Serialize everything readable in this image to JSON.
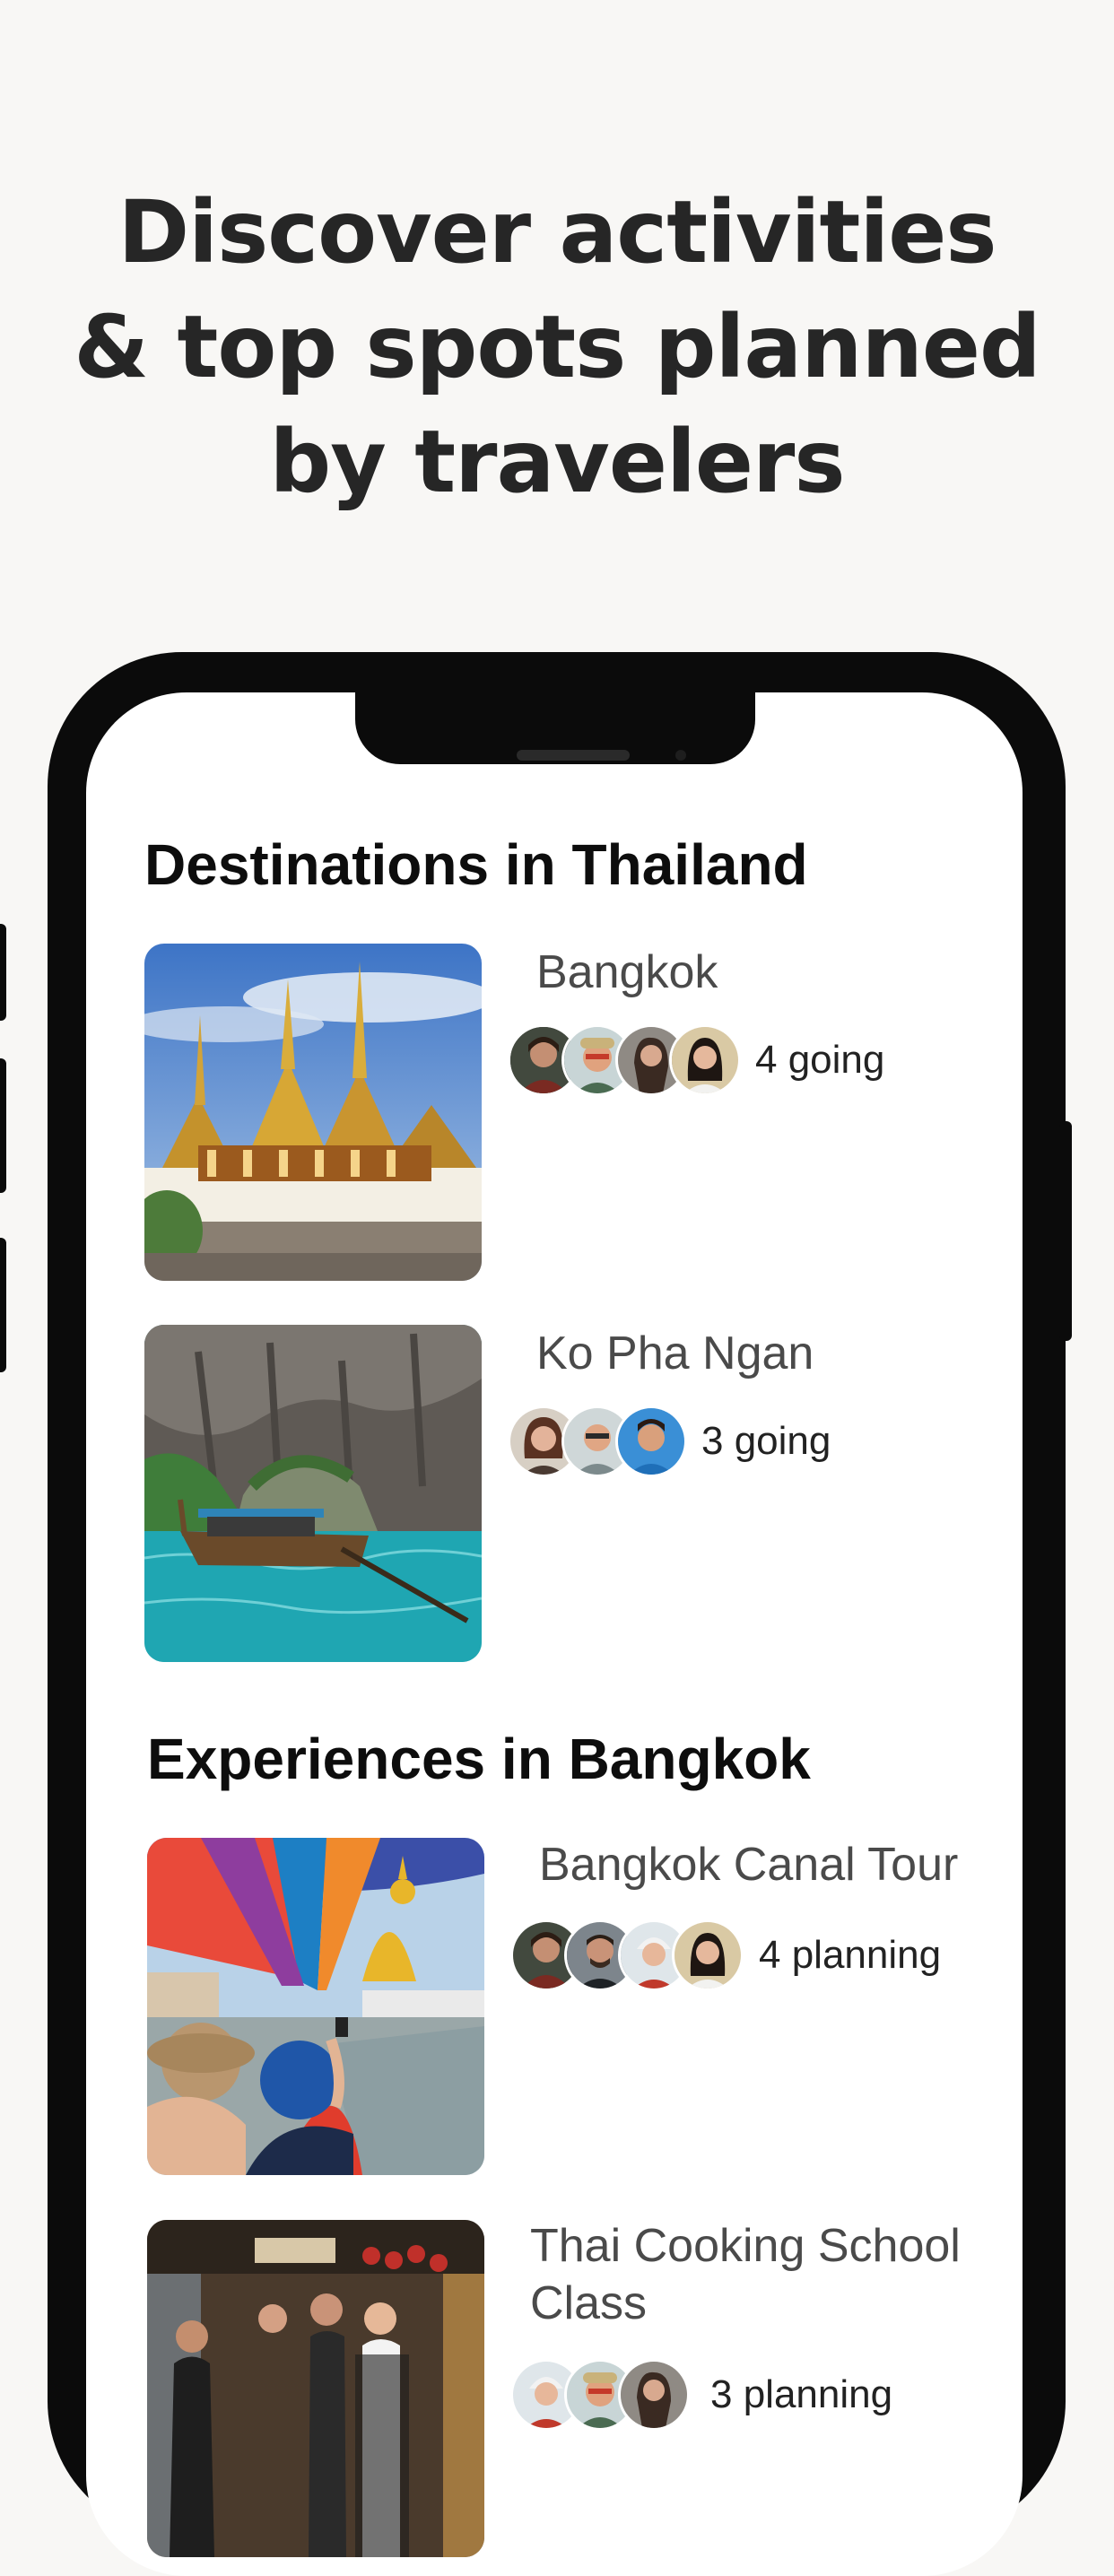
{
  "headline": {
    "line1": "Discover activities",
    "line2": "& top spots planned",
    "line3": "by travelers"
  },
  "destinations": {
    "title": "Destinations in Thailand",
    "items": [
      {
        "name": "Bangkok",
        "going": "4 going",
        "avatar_count": 4
      },
      {
        "name": "Ko Pha Ngan",
        "going": "3 going",
        "avatar_count": 3
      }
    ]
  },
  "experiences": {
    "title": "Experiences in Bangkok",
    "items": [
      {
        "name": "Bangkok Canal Tour",
        "planning": "4 planning",
        "avatar_count": 4
      },
      {
        "name_line1": "Thai Cooking School",
        "name_line2": "Class",
        "planning": "3 planning",
        "avatar_count": 3
      }
    ]
  },
  "colors": {
    "page_bg": "#f8f7f5",
    "headline": "#262626",
    "phone_frame": "#0b0b0b",
    "screen_bg": "#ffffff"
  }
}
